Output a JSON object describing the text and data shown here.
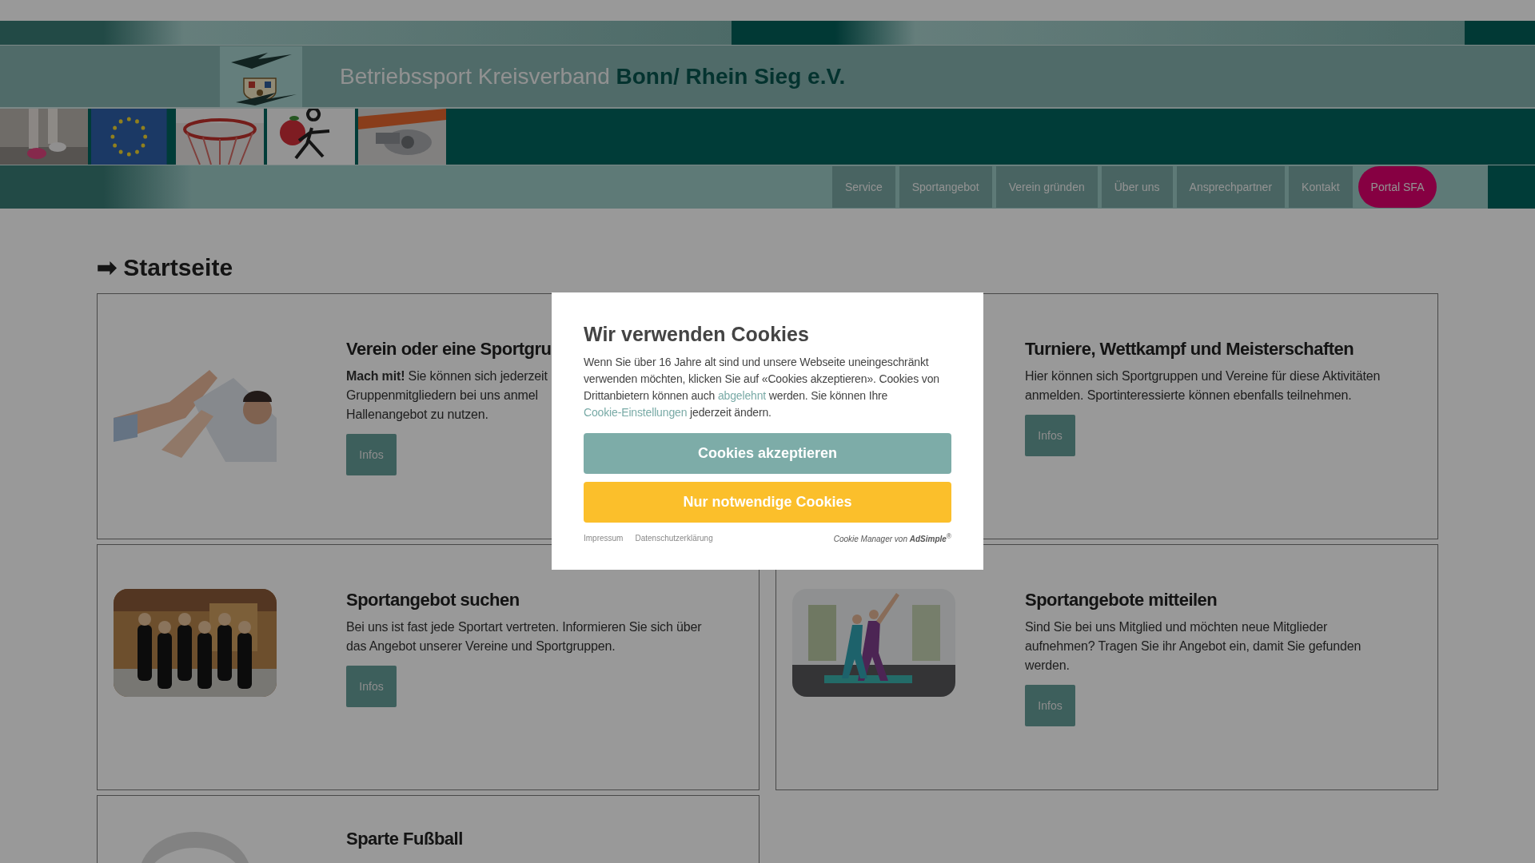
{
  "site": {
    "title": "Betriebssport Kreisverband",
    "title_highlight": "Bonn/ Rhein Sieg e.V."
  },
  "nav": [
    {
      "label": "Service",
      "kind": "plain"
    },
    {
      "label": "Sportangebot",
      "kind": "plain"
    },
    {
      "label": "Verein gründen",
      "kind": "plain"
    },
    {
      "label": "Über uns",
      "kind": "plain"
    },
    {
      "label": "Ansprechpartner",
      "kind": "plain"
    },
    {
      "label": "Kontakt",
      "kind": "plain"
    },
    {
      "label": "Portal SFA",
      "kind": "pill"
    }
  ],
  "heading": {
    "arrow": "➡",
    "text": "Startseite"
  },
  "cards": [
    {
      "image": {
        "kind": "picture"
      },
      "title": "Verein oder eine Sportgru",
      "body_lines": [
        "**Mach mit!** Sie können sich jederzeit",
        "Gruppenmitgliedern bei uns anmel",
        "Hallenangebot zu nutzen."
      ],
      "button": "Infos"
    },
    {
      "title": "Turniere, Wettkampf und Meisterschaften",
      "body_lines": [
        "Hier können sich Sportgruppen und Vereine für diese Aktivitäten",
        "anmelden. Sportinteressierte können ebenfalls teilnehmen."
      ],
      "button": "Infos"
    },
    {
      "image": {
        "kind": "picture"
      },
      "title": "Sportangebot suchen",
      "body_lines": [
        "Bei uns ist fast jede Sportart vertreten. Informieren Sie sich über",
        "das Angebot unserer Vereine und Sportgruppen."
      ],
      "button": "Infos"
    },
    {
      "image": {
        "kind": "picture"
      },
      "title": "Sportangebote mitteilen",
      "body_lines": [
        "Sind Sie bei uns Mitglied und möchten neue Mitglieder",
        "aufnehmen? Tragen Sie ihr Angebot ein, damit Sie gefunden",
        "werden."
      ],
      "button": "Infos"
    },
    {
      "image": {
        "kind": "picture"
      },
      "title": "Sparte Fußball"
    }
  ],
  "cookie_dialog": {
    "title": "Wir verwenden Cookies",
    "body": [
      {
        "kind": "text",
        "text": "Wenn Sie über 16 Jahre alt sind und unsere Webseite uneingeschränkt verwenden möchten, klicken Sie auf «Cookies akzeptieren». Cookies von Drittanbietern können auch "
      },
      {
        "kind": "link",
        "text": "abgelehnt"
      },
      {
        "kind": "text",
        "text": " werden. Sie können Ihre "
      },
      {
        "kind": "link",
        "text": "Cookie-Einstellungen"
      },
      {
        "kind": "text",
        "text": " jederzeit ändern."
      }
    ],
    "accept_button": "Cookies akzeptieren",
    "necessary_button": "Nur notwendige Cookies",
    "footer_links": [
      "Impressum",
      "Datenschutzerklärung"
    ],
    "credit": "Cookie Manager von **AdSimple**$^{®}$"
  }
}
